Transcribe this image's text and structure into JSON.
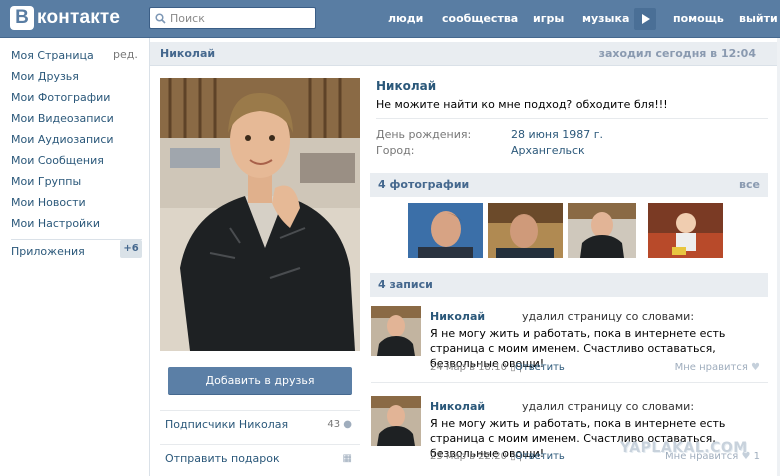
{
  "header": {
    "logo_letter": "В",
    "logo_text": "контакте",
    "search_placeholder": "Поиск",
    "nav": [
      "люди",
      "сообщества",
      "игры",
      "музыка",
      "помощь",
      "выйти"
    ]
  },
  "left_menu": {
    "items": [
      "Моя Страница",
      "Мои Друзья",
      "Мои Фотографии",
      "Мои Видеозаписи",
      "Мои Аудиозаписи",
      "Мои Сообщения",
      "Мои Группы",
      "Мои Новости",
      "Мои Настройки"
    ],
    "edit_label": "ред.",
    "apps_label": "Приложения",
    "apps_badge": "+6"
  },
  "profile": {
    "header_name": "Николай",
    "online_status": "заходил сегодня в 12:04",
    "name": "Николай",
    "status": "Не можите найти ко мне подход? обходите бля!!!",
    "fields": [
      {
        "label": "День рождения:",
        "value": "28 июня 1987 г."
      },
      {
        "label": "Город:",
        "value": "Архангельск"
      }
    ],
    "add_friend_label": "Добавить в друзья",
    "followers_label": "Подписчики Николая",
    "followers_count": "43",
    "gift_label": "Отправить подарок"
  },
  "photos": {
    "title": "4 фотографии",
    "all_label": "все"
  },
  "wall": {
    "title": "4 записи",
    "posts": [
      {
        "author": "Николай",
        "action": "удалил страницу со словами:",
        "text": "Я не могу жить и работать, пока в интернете есть страница с моим именем. Счастливо оставаться, безвольные овощи!",
        "date": "24 мар в 18:10",
        "reply": "Ответить",
        "like": "Мне нравится",
        "like_count": ""
      },
      {
        "author": "Николай",
        "action": "удалил страницу со словами:",
        "text": "Я не могу жить и работать, пока в интернете есть страница с моим именем. Счастливо оставаться, безвольные овощи!",
        "date": "23 мар в 22:20",
        "reply": "Ответить",
        "like": "Мне нравится",
        "like_count": "1"
      }
    ]
  },
  "watermark": "YAPLAKAL.COM",
  "colors": {
    "accent": "#597da3",
    "link": "#2b587a",
    "block_bg": "#e9edf1"
  }
}
